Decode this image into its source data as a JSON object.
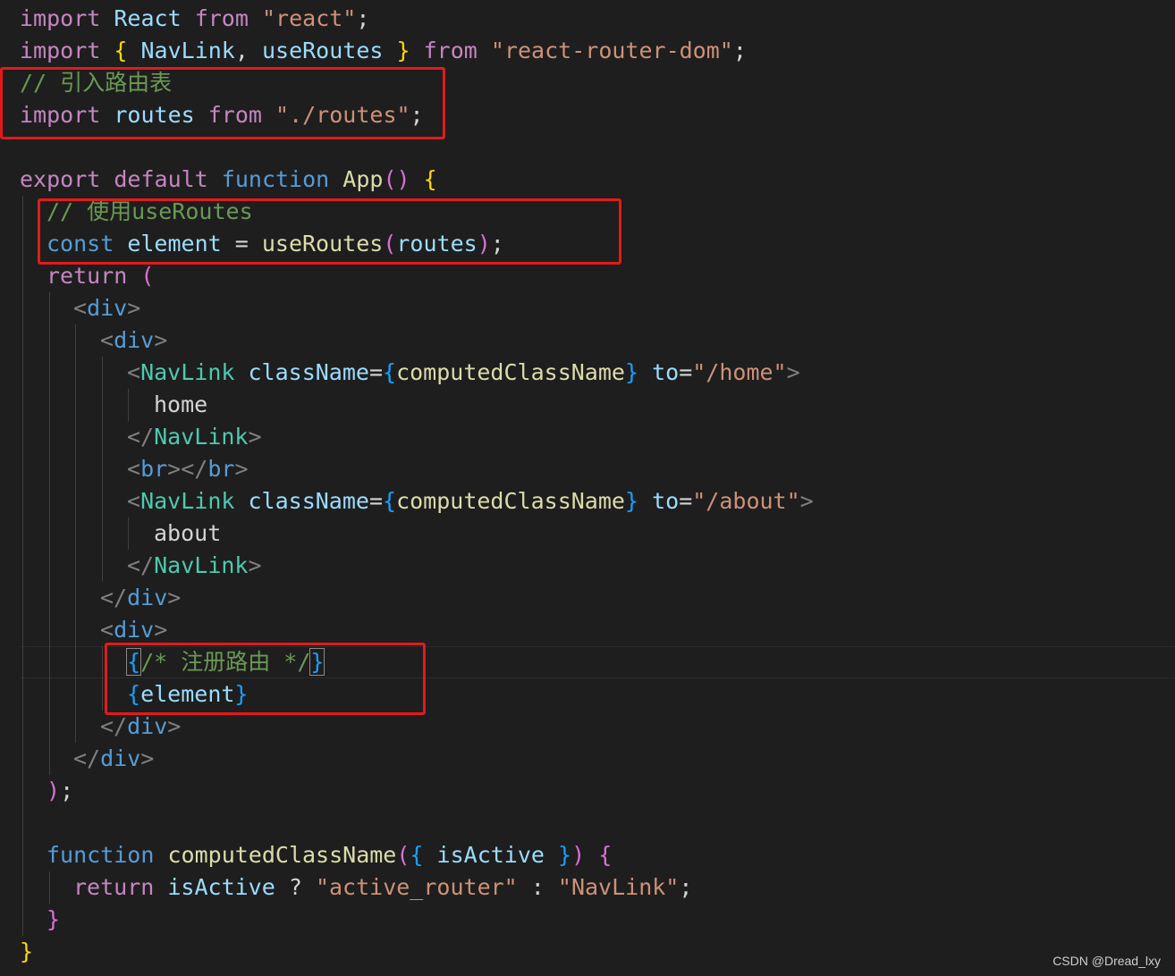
{
  "code": {
    "language": "jsx",
    "lines": [
      {
        "indent": 0,
        "tokens": [
          {
            "t": "import",
            "c": "kw"
          },
          {
            "t": " ",
            "c": "plain"
          },
          {
            "t": "React",
            "c": "var"
          },
          {
            "t": " ",
            "c": "plain"
          },
          {
            "t": "from",
            "c": "kw"
          },
          {
            "t": " ",
            "c": "plain"
          },
          {
            "t": "\"react\"",
            "c": "str"
          },
          {
            "t": ";",
            "c": "plain"
          }
        ]
      },
      {
        "indent": 0,
        "tokens": [
          {
            "t": "import",
            "c": "kw"
          },
          {
            "t": " ",
            "c": "plain"
          },
          {
            "t": "{",
            "c": "br1"
          },
          {
            "t": " ",
            "c": "plain"
          },
          {
            "t": "NavLink",
            "c": "var"
          },
          {
            "t": ", ",
            "c": "plain"
          },
          {
            "t": "useRoutes",
            "c": "var"
          },
          {
            "t": " ",
            "c": "plain"
          },
          {
            "t": "}",
            "c": "br1"
          },
          {
            "t": " ",
            "c": "plain"
          },
          {
            "t": "from",
            "c": "kw"
          },
          {
            "t": " ",
            "c": "plain"
          },
          {
            "t": "\"react-router-dom\"",
            "c": "str"
          },
          {
            "t": ";",
            "c": "plain"
          }
        ]
      },
      {
        "indent": 0,
        "tokens": [
          {
            "t": "// 引入路由表",
            "c": "cm"
          }
        ]
      },
      {
        "indent": 0,
        "tokens": [
          {
            "t": "import",
            "c": "kw"
          },
          {
            "t": " ",
            "c": "plain"
          },
          {
            "t": "routes",
            "c": "var"
          },
          {
            "t": " ",
            "c": "plain"
          },
          {
            "t": "from",
            "c": "kw"
          },
          {
            "t": " ",
            "c": "plain"
          },
          {
            "t": "\"./routes\"",
            "c": "str"
          },
          {
            "t": ";",
            "c": "plain"
          }
        ]
      },
      {
        "indent": 0,
        "tokens": []
      },
      {
        "indent": 0,
        "tokens": [
          {
            "t": "export",
            "c": "kw"
          },
          {
            "t": " ",
            "c": "plain"
          },
          {
            "t": "default",
            "c": "kw"
          },
          {
            "t": " ",
            "c": "plain"
          },
          {
            "t": "function",
            "c": "dec"
          },
          {
            "t": " ",
            "c": "plain"
          },
          {
            "t": "App",
            "c": "fn"
          },
          {
            "t": "()",
            "c": "br2"
          },
          {
            "t": " ",
            "c": "plain"
          },
          {
            "t": "{",
            "c": "br1"
          }
        ]
      },
      {
        "indent": 1,
        "tokens": [
          {
            "t": "// 使用useRoutes",
            "c": "cm"
          }
        ]
      },
      {
        "indent": 1,
        "tokens": [
          {
            "t": "const",
            "c": "dec"
          },
          {
            "t": " ",
            "c": "plain"
          },
          {
            "t": "element",
            "c": "var"
          },
          {
            "t": " = ",
            "c": "plain"
          },
          {
            "t": "useRoutes",
            "c": "fn"
          },
          {
            "t": "(",
            "c": "br2"
          },
          {
            "t": "routes",
            "c": "var"
          },
          {
            "t": ")",
            "c": "br2"
          },
          {
            "t": ";",
            "c": "plain"
          }
        ]
      },
      {
        "indent": 1,
        "tokens": [
          {
            "t": "return",
            "c": "kw"
          },
          {
            "t": " ",
            "c": "plain"
          },
          {
            "t": "(",
            "c": "br2"
          }
        ]
      },
      {
        "indent": 2,
        "tokens": [
          {
            "t": "<",
            "c": "ang"
          },
          {
            "t": "div",
            "c": "html"
          },
          {
            "t": ">",
            "c": "ang"
          }
        ]
      },
      {
        "indent": 3,
        "tokens": [
          {
            "t": "<",
            "c": "ang"
          },
          {
            "t": "div",
            "c": "html"
          },
          {
            "t": ">",
            "c": "ang"
          }
        ]
      },
      {
        "indent": 4,
        "tokens": [
          {
            "t": "<",
            "c": "ang"
          },
          {
            "t": "NavLink",
            "c": "tag"
          },
          {
            "t": " ",
            "c": "plain"
          },
          {
            "t": "className",
            "c": "attr"
          },
          {
            "t": "=",
            "c": "plain"
          },
          {
            "t": "{",
            "c": "br3"
          },
          {
            "t": "computedClassName",
            "c": "fn"
          },
          {
            "t": "}",
            "c": "br3"
          },
          {
            "t": " ",
            "c": "plain"
          },
          {
            "t": "to",
            "c": "attr"
          },
          {
            "t": "=",
            "c": "plain"
          },
          {
            "t": "\"/home\"",
            "c": "str"
          },
          {
            "t": ">",
            "c": "ang"
          }
        ]
      },
      {
        "indent": 5,
        "tokens": [
          {
            "t": "home",
            "c": "plain"
          }
        ]
      },
      {
        "indent": 4,
        "tokens": [
          {
            "t": "</",
            "c": "ang"
          },
          {
            "t": "NavLink",
            "c": "tag"
          },
          {
            "t": ">",
            "c": "ang"
          }
        ]
      },
      {
        "indent": 4,
        "tokens": [
          {
            "t": "<",
            "c": "ang"
          },
          {
            "t": "br",
            "c": "html"
          },
          {
            "t": "></",
            "c": "ang"
          },
          {
            "t": "br",
            "c": "html"
          },
          {
            "t": ">",
            "c": "ang"
          }
        ]
      },
      {
        "indent": 4,
        "tokens": [
          {
            "t": "<",
            "c": "ang"
          },
          {
            "t": "NavLink",
            "c": "tag"
          },
          {
            "t": " ",
            "c": "plain"
          },
          {
            "t": "className",
            "c": "attr"
          },
          {
            "t": "=",
            "c": "plain"
          },
          {
            "t": "{",
            "c": "br3"
          },
          {
            "t": "computedClassName",
            "c": "fn"
          },
          {
            "t": "}",
            "c": "br3"
          },
          {
            "t": " ",
            "c": "plain"
          },
          {
            "t": "to",
            "c": "attr"
          },
          {
            "t": "=",
            "c": "plain"
          },
          {
            "t": "\"/about\"",
            "c": "str"
          },
          {
            "t": ">",
            "c": "ang"
          }
        ]
      },
      {
        "indent": 5,
        "tokens": [
          {
            "t": "about",
            "c": "plain"
          }
        ]
      },
      {
        "indent": 4,
        "tokens": [
          {
            "t": "</",
            "c": "ang"
          },
          {
            "t": "NavLink",
            "c": "tag"
          },
          {
            "t": ">",
            "c": "ang"
          }
        ]
      },
      {
        "indent": 3,
        "tokens": [
          {
            "t": "</",
            "c": "ang"
          },
          {
            "t": "div",
            "c": "html"
          },
          {
            "t": ">",
            "c": "ang"
          }
        ]
      },
      {
        "indent": 3,
        "tokens": [
          {
            "t": "<",
            "c": "ang"
          },
          {
            "t": "div",
            "c": "html"
          },
          {
            "t": ">",
            "c": "ang"
          }
        ]
      },
      {
        "indent": 4,
        "tokens": [
          {
            "t": "{",
            "c": "br3 brm"
          },
          {
            "t": "/* 注册路由 */",
            "c": "cm"
          },
          {
            "t": "}",
            "c": "br3 brm"
          }
        ]
      },
      {
        "indent": 4,
        "tokens": [
          {
            "t": "{",
            "c": "br3"
          },
          {
            "t": "element",
            "c": "var"
          },
          {
            "t": "}",
            "c": "br3"
          }
        ]
      },
      {
        "indent": 3,
        "tokens": [
          {
            "t": "</",
            "c": "ang"
          },
          {
            "t": "div",
            "c": "html"
          },
          {
            "t": ">",
            "c": "ang"
          }
        ]
      },
      {
        "indent": 2,
        "tokens": [
          {
            "t": "</",
            "c": "ang"
          },
          {
            "t": "div",
            "c": "html"
          },
          {
            "t": ">",
            "c": "ang"
          }
        ]
      },
      {
        "indent": 1,
        "tokens": [
          {
            "t": ")",
            "c": "br2"
          },
          {
            "t": ";",
            "c": "plain"
          }
        ]
      },
      {
        "indent": 0,
        "tokens": []
      },
      {
        "indent": 1,
        "tokens": [
          {
            "t": "function",
            "c": "dec"
          },
          {
            "t": " ",
            "c": "plain"
          },
          {
            "t": "computedClassName",
            "c": "fn"
          },
          {
            "t": "(",
            "c": "br2"
          },
          {
            "t": "{",
            "c": "br3"
          },
          {
            "t": " ",
            "c": "plain"
          },
          {
            "t": "isActive",
            "c": "var"
          },
          {
            "t": " ",
            "c": "plain"
          },
          {
            "t": "}",
            "c": "br3"
          },
          {
            "t": ")",
            "c": "br2"
          },
          {
            "t": " ",
            "c": "plain"
          },
          {
            "t": "{",
            "c": "br2"
          }
        ]
      },
      {
        "indent": 2,
        "tokens": [
          {
            "t": "return",
            "c": "kw"
          },
          {
            "t": " ",
            "c": "plain"
          },
          {
            "t": "isActive",
            "c": "var"
          },
          {
            "t": " ? ",
            "c": "plain"
          },
          {
            "t": "\"active_router\"",
            "c": "str"
          },
          {
            "t": " : ",
            "c": "plain"
          },
          {
            "t": "\"NavLink\"",
            "c": "str"
          },
          {
            "t": ";",
            "c": "plain"
          }
        ]
      },
      {
        "indent": 1,
        "tokens": [
          {
            "t": "}",
            "c": "br2"
          }
        ]
      },
      {
        "indent": 0,
        "tokens": [
          {
            "t": "}",
            "c": "br1"
          }
        ]
      }
    ]
  },
  "watermark": "CSDN @Dread_lxy",
  "colors": {
    "background": "#1e1e1e",
    "highlight_box": "#e31a1a",
    "keyword": "#c586c0",
    "declaration": "#569cd6",
    "variable": "#9cdcfe",
    "function": "#dcdcaa",
    "string": "#ce9178",
    "comment": "#6a9955",
    "jsx_tag": "#4ec9b0"
  }
}
